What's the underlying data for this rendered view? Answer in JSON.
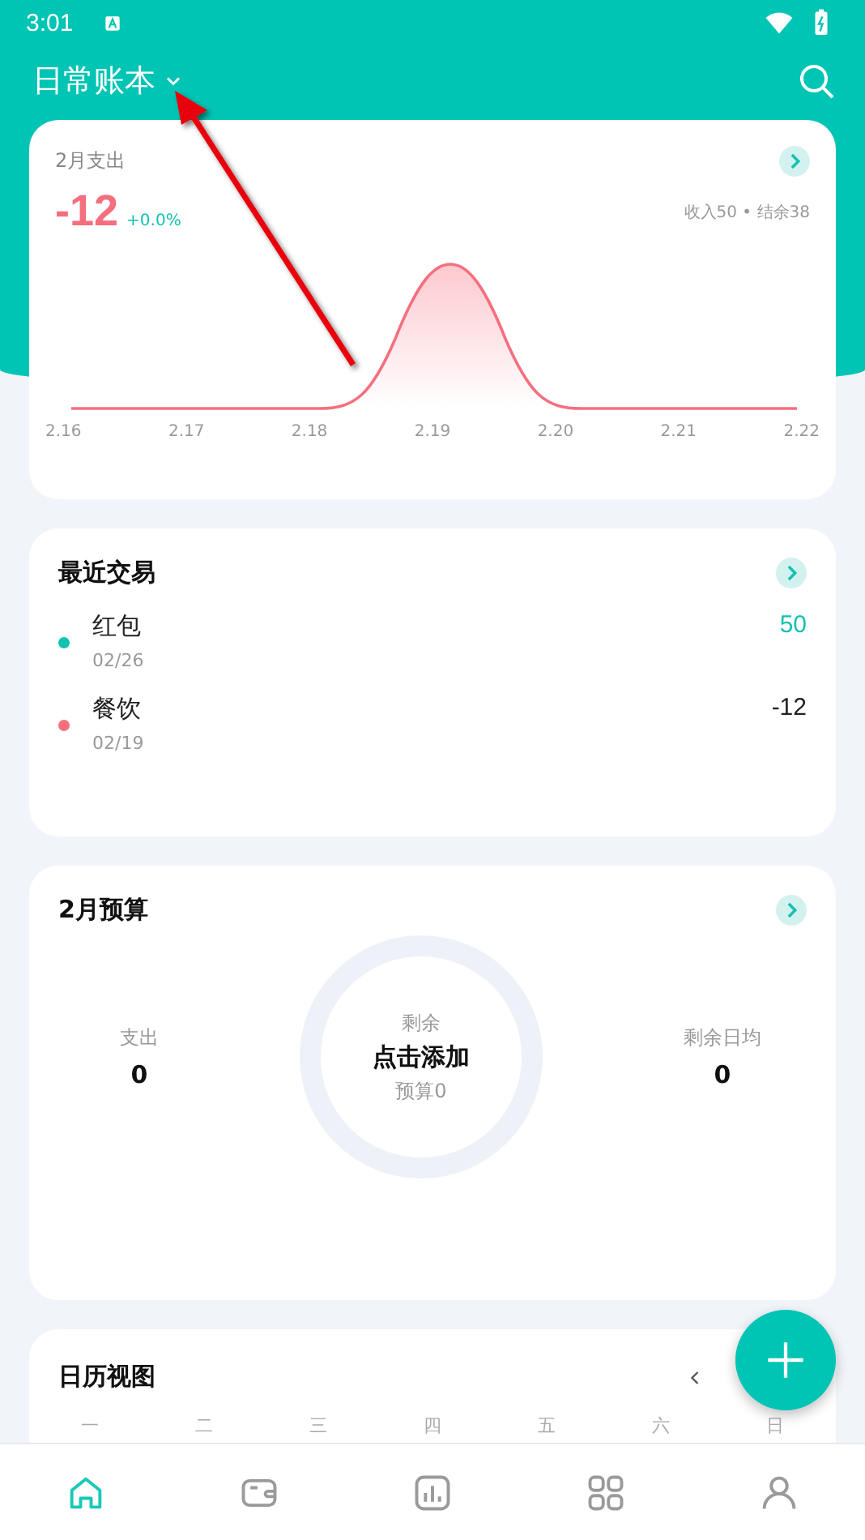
{
  "status_bar": {
    "time": "3:01"
  },
  "header": {
    "title": "日常账本"
  },
  "spending_card": {
    "title": "2月支出",
    "amount": "-12",
    "change": "+0.0%",
    "summary": "收入50 • 结余38",
    "x_labels": [
      "2.16",
      "2.17",
      "2.18",
      "2.19",
      "2.20",
      "2.21",
      "2.22"
    ]
  },
  "recent": {
    "title": "最近交易",
    "items": [
      {
        "name": "红包",
        "date": "02/26",
        "amount": "50",
        "color": "#12c2b1",
        "kind": "income"
      },
      {
        "name": "餐饮",
        "date": "02/19",
        "amount": "-12",
        "color": "#f56f7e",
        "kind": "expense"
      }
    ]
  },
  "budget": {
    "title": "2月预算",
    "left_label": "支出",
    "left_value": "0",
    "center_top": "剩余",
    "center_main": "点击添加",
    "center_bottom": "预算0",
    "right_label": "剩余日均",
    "right_value": "0"
  },
  "calendar": {
    "title": "日历视图",
    "weekdays": [
      "一",
      "二",
      "三",
      "四",
      "五",
      "六",
      "日"
    ]
  },
  "nav": [
    {
      "kind": "home",
      "selected": true
    },
    {
      "kind": "wallet",
      "selected": false
    },
    {
      "kind": "chart",
      "selected": false
    },
    {
      "kind": "apps",
      "selected": false
    },
    {
      "kind": "profile",
      "selected": false
    }
  ]
}
